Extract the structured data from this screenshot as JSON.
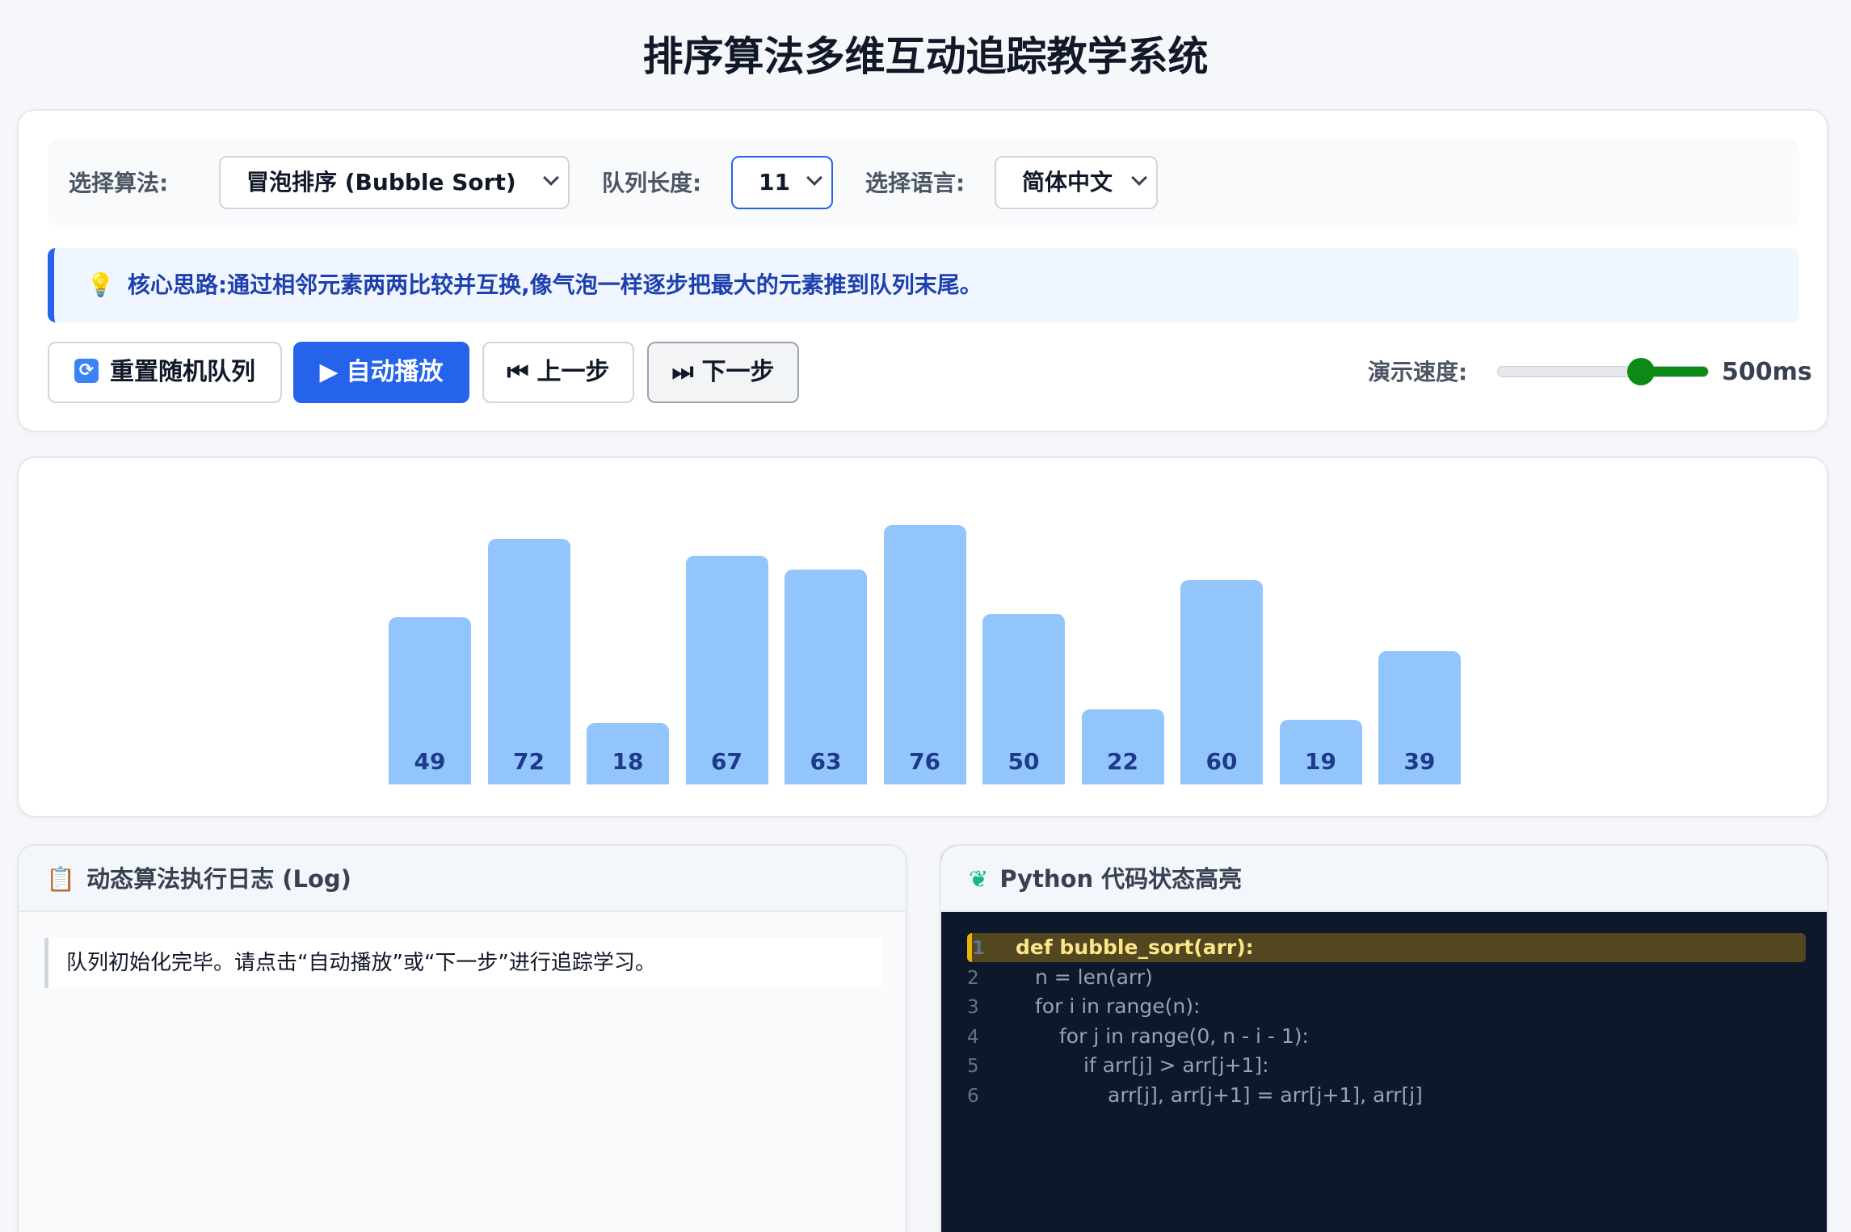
{
  "page_title": "排序算法多维互动追踪教学系统",
  "settings": {
    "algorithm_label": "选择算法:",
    "algorithm_value": "冒泡排序 (Bubble Sort)",
    "length_label": "队列长度:",
    "length_value": "11",
    "language_label": "选择语言:",
    "language_value": "简体中文"
  },
  "hint": {
    "icon": "lightbulb-icon",
    "text": "核心思路:通过相邻元素两两比较并互换,像气泡一样逐步把最大的元素推到队列末尾。"
  },
  "buttons": {
    "reset": "重置随机队列",
    "autoplay": "自动播放",
    "prev": "上一步",
    "next": "下一步"
  },
  "speed": {
    "label": "演示速度:",
    "value_text": "500ms",
    "slider_fraction": 0.7
  },
  "chart_data": {
    "type": "bar",
    "values": [
      49,
      72,
      18,
      67,
      63,
      76,
      50,
      22,
      60,
      19,
      39
    ],
    "bar_color": "#93c5fd",
    "label_color": "#1e3a8a"
  },
  "log": {
    "title": "动态算法执行日志 (Log)",
    "icon": "clipboard-icon",
    "entries": [
      "队列初始化完毕。请点击“自动播放”或“下一步”进行追踪学习。"
    ]
  },
  "code": {
    "title": "Python 代码状态高亮",
    "icon": "python-icon",
    "highlight_line": 1,
    "lines": [
      "def bubble_sort(arr):",
      "n = len(arr)",
      "for i in range(n):",
      "for j in range(0, n - i - 1):",
      "if arr[j] > arr[j+1]:",
      "arr[j], arr[j+1] = arr[j+1], arr[j]"
    ],
    "line_numbers": [
      "1",
      "2",
      "3",
      "4",
      "5",
      "6"
    ]
  },
  "colors": {
    "accent": "#2563eb",
    "slider": "#0b8a16",
    "highlight": "#eab308"
  }
}
